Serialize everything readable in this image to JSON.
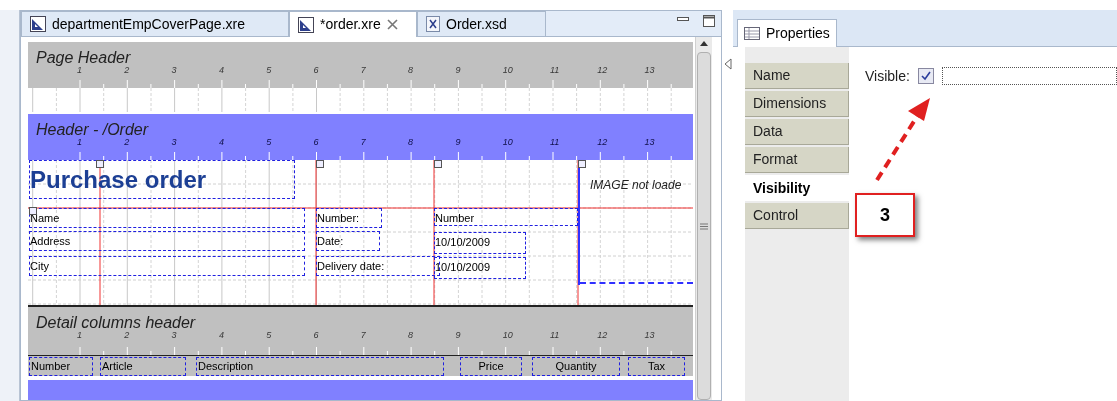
{
  "editor_tabs": [
    {
      "label": "departmentEmpCoverPage.xre",
      "kind": "report",
      "selected": false
    },
    {
      "label": "*order.xre",
      "kind": "report",
      "selected": true
    },
    {
      "label": "Order.xsd",
      "kind": "schema",
      "selected": false
    }
  ],
  "page_header": {
    "title": "Page Header",
    "ruler": [
      "1",
      "2",
      "3",
      "4",
      "5",
      "6",
      "7",
      "8",
      "9",
      "10",
      "11",
      "12",
      "13"
    ]
  },
  "order_header": {
    "title": "Header - /Order",
    "ruler": [
      "1",
      "2",
      "3",
      "4",
      "5",
      "6",
      "7",
      "8",
      "9",
      "10",
      "11",
      "12",
      "13"
    ],
    "heading": "Purchase order",
    "image_text": "IMAGE not loade",
    "customer_fields": [
      "Name",
      "Address",
      "City"
    ],
    "order_labels": [
      "Number:",
      "Date:",
      "Delivery date:"
    ],
    "order_values": [
      "Number",
      "10/10/2009",
      "10/10/2009"
    ]
  },
  "detail_columns_header": {
    "title": "Detail columns header",
    "ruler": [
      "1",
      "2",
      "3",
      "4",
      "5",
      "6",
      "7",
      "8",
      "9",
      "10",
      "11",
      "12",
      "13"
    ],
    "columns": [
      "Number",
      "Article",
      "Description",
      "Price",
      "Quantity",
      "Tax"
    ]
  },
  "properties": {
    "tab": "Properties",
    "sections": [
      {
        "label": "Name",
        "selected": false
      },
      {
        "label": "Dimensions",
        "selected": false
      },
      {
        "label": "Data",
        "selected": false
      },
      {
        "label": "Format",
        "selected": false
      },
      {
        "label": "Visibility",
        "selected": true
      },
      {
        "label": "Control",
        "selected": false
      }
    ],
    "visible": {
      "label": "Visible:",
      "checked": true
    },
    "callout": "3"
  }
}
